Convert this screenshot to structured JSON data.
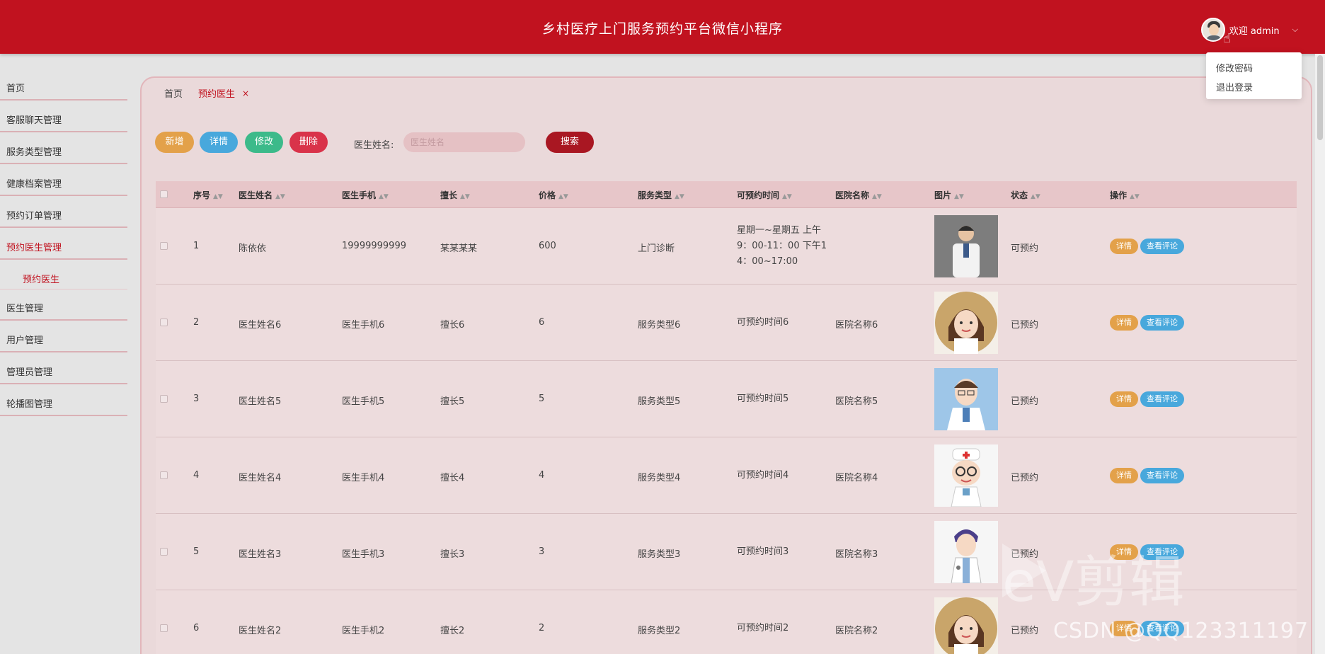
{
  "app": {
    "title": "乡村医疗上门服务预约平台微信小程序",
    "welcome": "欢迎 admin",
    "user_menu": [
      "修改密码",
      "退出登录"
    ]
  },
  "sidebar": {
    "items": [
      {
        "label": "首页"
      },
      {
        "label": "客服聊天管理"
      },
      {
        "label": "服务类型管理"
      },
      {
        "label": "健康档案管理"
      },
      {
        "label": "预约订单管理"
      },
      {
        "label": "预约医生管理"
      },
      {
        "label": "预约医生"
      },
      {
        "label": "医生管理"
      },
      {
        "label": "用户管理"
      },
      {
        "label": "管理员管理"
      },
      {
        "label": "轮播图管理"
      }
    ]
  },
  "breadcrumb": {
    "home": "首页",
    "tab": "预约医生",
    "close": "×"
  },
  "toolbar": {
    "add": "新增",
    "detail": "详情",
    "edit": "修改",
    "delete": "删除",
    "search_label": "医生姓名:",
    "search_placeholder": "医生姓名",
    "search_button": "搜索"
  },
  "table": {
    "headers": [
      "序号",
      "医生姓名",
      "医生手机",
      "擅长",
      "价格",
      "服务类型",
      "可预约时间",
      "医院名称",
      "图片",
      "状态",
      "操作"
    ],
    "rows": [
      {
        "no": "1",
        "name": "陈依依",
        "phone": "19999999999",
        "skill": "某某某某",
        "price": "600",
        "service": "上门诊断",
        "time_lines": [
          "星期一~星期五 上午",
          "9：00-11：00 下午1",
          "4：00~17:00"
        ],
        "hospital": "",
        "status": "可预约",
        "img": "photo-male"
      },
      {
        "no": "2",
        "name": "医生姓名6",
        "phone": "医生手机6",
        "skill": "擅长6",
        "price": "6",
        "service": "服务类型6",
        "time_lines": [
          "可预约时间6"
        ],
        "hospital": "医院名称6",
        "status": "已预约",
        "img": "cartoon-woman"
      },
      {
        "no": "3",
        "name": "医生姓名5",
        "phone": "医生手机5",
        "skill": "擅长5",
        "price": "5",
        "service": "服务类型5",
        "time_lines": [
          "可预约时间5"
        ],
        "hospital": "医院名称5",
        "status": "已预约",
        "img": "cartoon-man-blue"
      },
      {
        "no": "4",
        "name": "医生姓名4",
        "phone": "医生手机4",
        "skill": "擅长4",
        "price": "4",
        "service": "服务类型4",
        "time_lines": [
          "可预约时间4"
        ],
        "hospital": "医院名称4",
        "status": "已预约",
        "img": "cartoon-nurse"
      },
      {
        "no": "5",
        "name": "医生姓名3",
        "phone": "医生手机3",
        "skill": "擅长3",
        "price": "3",
        "service": "服务类型3",
        "time_lines": [
          "可预约时间3"
        ],
        "hospital": "医院名称3",
        "status": "已预约",
        "img": "cartoon-man-purple"
      },
      {
        "no": "6",
        "name": "医生姓名2",
        "phone": "医生手机2",
        "skill": "擅长2",
        "price": "2",
        "service": "服务类型2",
        "time_lines": [
          "可预约时间2"
        ],
        "hospital": "医院名称2",
        "status": "已预约",
        "img": "cartoon-woman"
      }
    ],
    "op_detail": "详情",
    "op_review": "查看评论"
  },
  "watermarks": {
    "ev": "eV剪辑",
    "csdn": "CSDN @QQ123311197"
  },
  "colors": {
    "brand": "#c1121f",
    "add": "#e3a14a",
    "detail": "#48a8dc",
    "edit": "#3cba8a",
    "delete": "#d9334a",
    "search": "#a91722"
  }
}
